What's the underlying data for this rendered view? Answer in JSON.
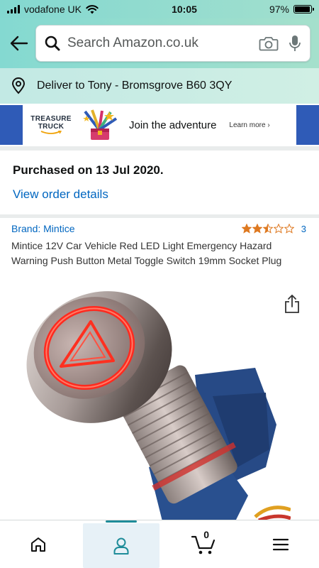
{
  "status_bar": {
    "carrier": "vodafone UK",
    "time": "10:05",
    "battery": "97%",
    "battery_level": 0.97
  },
  "search": {
    "placeholder": "Search Amazon.co.uk"
  },
  "delivery": {
    "text": "Deliver to Tony - Bromsgrove B60 3QY"
  },
  "banner": {
    "logo_line1": "TREASURE",
    "logo_line2": "TRUCK",
    "title": "Join the adventure",
    "link": "Learn more ›",
    "edge_color": "#2f5bb7"
  },
  "order": {
    "purchased": "Purchased on 13 Jul 2020.",
    "details_link": "View order details"
  },
  "product": {
    "brand": "Brand: Mintice",
    "rating": 2.5,
    "rating_max": 5,
    "rating_count": "3",
    "title": "Mintice 12V Car Vehicle Red LED Light Emergency Hazard Warning Push Button Metal Toggle Switch 19mm Socket Plug"
  },
  "bottom_nav": {
    "items": [
      {
        "icon": "home-icon"
      },
      {
        "icon": "account-icon",
        "active": true
      },
      {
        "icon": "cart-icon",
        "count": "0"
      },
      {
        "icon": "menu-icon"
      }
    ]
  },
  "colors": {
    "accent": "#1e8c99",
    "link": "#0066c0",
    "star": "#de7921"
  }
}
